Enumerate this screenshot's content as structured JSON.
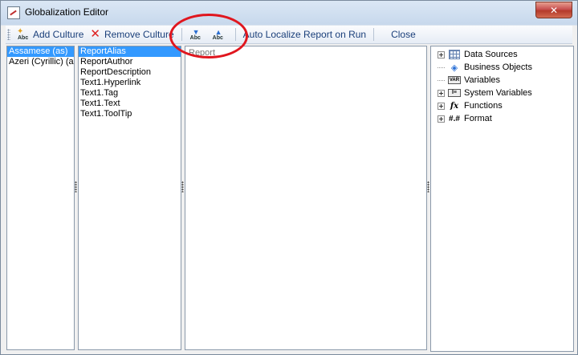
{
  "window": {
    "title": "Globalization Editor",
    "close_glyph": "✕"
  },
  "toolbar": {
    "add_culture": "Add Culture",
    "remove_culture": "Remove Culture",
    "abc_label": "Abc",
    "auto_localize": "Auto Localize Report on Run",
    "close": "Close"
  },
  "cultures": [
    "Assamese (as)",
    "Azeri (Cyrillic) (az"
  ],
  "properties": [
    "ReportAlias",
    "ReportAuthor",
    "ReportDescription",
    "Text1.Hyperlink",
    "Text1.Tag",
    "Text1.Text",
    "Text1.ToolTip"
  ],
  "editor": {
    "text": "Report"
  },
  "dictionary": [
    {
      "label": "Data Sources",
      "icon": "data-sources-icon",
      "expandable": true
    },
    {
      "label": "Business Objects",
      "icon": "business-objects-icon",
      "expandable": false
    },
    {
      "label": "Variables",
      "icon": "variables-icon",
      "expandable": false
    },
    {
      "label": "System Variables",
      "icon": "system-variables-icon",
      "expandable": true
    },
    {
      "label": "Functions",
      "icon": "functions-icon",
      "expandable": true
    },
    {
      "label": "Format",
      "icon": "format-icon",
      "expandable": true
    }
  ],
  "colors": {
    "selection": "#3399ff",
    "annotation": "#e0161e"
  }
}
